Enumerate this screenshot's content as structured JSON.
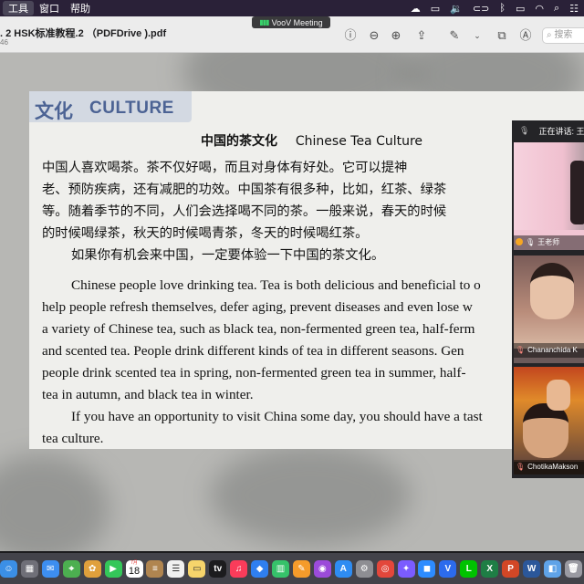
{
  "menubar": {
    "items": [
      "工具",
      "窗口",
      "帮助"
    ],
    "status_icons": [
      "cloud-icon",
      "cast-icon",
      "volume-icon",
      "link-icon",
      "bluetooth-icon",
      "battery-icon",
      "wifi-icon",
      "spotlight-icon",
      "control-center-icon"
    ]
  },
  "meeting_indicator": {
    "label": "VooV Meeting",
    "color": "#38d16a"
  },
  "window": {
    "title": ". 2 HSK标准教程.2 （PDFDrive ).pdf",
    "subtitle": "46",
    "search_placeholder": "搜索"
  },
  "page": {
    "culture_cn": "文化",
    "culture_en": "CULTURE",
    "title_cn": "中国的茶文化",
    "title_en": "Chinese Tea Culture",
    "cn_lines": [
      "中国人喜欢喝茶。茶不仅好喝，而且对身体有好处。它可以提神",
      "老、预防疾病，还有减肥的功效。中国茶有很多种，比如，红茶、绿茶",
      "等。随着季节的不同，人们会选择喝不同的茶。一般来说，春天的时候",
      "的时候喝绿茶，秋天的时候喝青茶，冬天的时候喝红茶。",
      "如果你有机会来中国，一定要体验一下中国的茶文化。"
    ],
    "en_lines": [
      "Chinese people love drinking tea. Tea is both delicious and beneficial to o",
      "help people refresh themselves, defer aging, prevent diseases and even lose w",
      "a variety of Chinese tea, such as black tea, non-fermented green tea, half-ferm",
      "and scented tea. People drink different kinds of tea in different seasons. Gen",
      "people drink scented tea in spring, non-fermented green tea in summer, half-",
      "tea in autumn, and black tea in winter.",
      "If you have an opportunity to visit China some day, you should have a tast",
      "tea culture."
    ]
  },
  "participants": {
    "header": "正在讲话: 王",
    "tiles": [
      {
        "name": "王老师"
      },
      {
        "name": "Chananchida K"
      },
      {
        "name": "ChotikaMakson"
      }
    ]
  },
  "dock": {
    "apps": [
      {
        "name": "finder-icon",
        "color": "#3b8fe6",
        "glyph": "☺"
      },
      {
        "name": "launchpad-icon",
        "color": "#6f6f78",
        "glyph": "▦"
      },
      {
        "name": "mail-icon",
        "color": "#3d8ef0",
        "glyph": "✉"
      },
      {
        "name": "maps-icon",
        "color": "#4caf50",
        "glyph": "⌖"
      },
      {
        "name": "photos-icon",
        "color": "#e0a03c",
        "glyph": "✿"
      },
      {
        "name": "facetime-icon",
        "color": "#34c759",
        "glyph": "▶"
      },
      {
        "name": "calendar-icon",
        "color": "#ffffff",
        "glyph": ""
      },
      {
        "name": "notes-brown-icon",
        "color": "#b08550",
        "glyph": "≡"
      },
      {
        "name": "reminders-icon",
        "color": "#f0f0f0",
        "glyph": "☰"
      },
      {
        "name": "notes-icon",
        "color": "#f6d46b",
        "glyph": "▭"
      },
      {
        "name": "tv-icon",
        "color": "#1c1c1e",
        "glyph": "tv"
      },
      {
        "name": "music-icon",
        "color": "#fa3c5a",
        "glyph": "♫"
      },
      {
        "name": "keynote-icon",
        "color": "#2f7ff0",
        "glyph": "◆"
      },
      {
        "name": "numbers-icon",
        "color": "#36c26a",
        "glyph": "▥"
      },
      {
        "name": "pages-icon",
        "color": "#f59b2b",
        "glyph": "✎"
      },
      {
        "name": "podcasts-icon",
        "color": "#9b4bd9",
        "glyph": "◉"
      },
      {
        "name": "appstore-icon",
        "color": "#2e8cf2",
        "glyph": "A"
      },
      {
        "name": "settings-icon",
        "color": "#8e8e93",
        "glyph": "⚙"
      },
      {
        "name": "chrome-icon",
        "color": "#e3473b",
        "glyph": "◎"
      },
      {
        "name": "messenger-icon",
        "color": "#7b5cff",
        "glyph": "✦"
      },
      {
        "name": "zoom-icon",
        "color": "#2d8cff",
        "glyph": "◼"
      },
      {
        "name": "voov-icon",
        "color": "#2c6bed",
        "glyph": "V"
      },
      {
        "name": "line-icon",
        "color": "#00c300",
        "glyph": "L"
      },
      {
        "name": "excel-icon",
        "color": "#1e7e45",
        "glyph": "X"
      },
      {
        "name": "powerpoint-icon",
        "color": "#d24726",
        "glyph": "P"
      },
      {
        "name": "word-icon",
        "color": "#2b579a",
        "glyph": "W"
      },
      {
        "name": "preview-icon",
        "color": "#5fa3e8",
        "glyph": "◧"
      },
      {
        "name": "trash-icon",
        "color": "#9a9aa2",
        "glyph": "🗑"
      }
    ],
    "calendar": {
      "month": "7月",
      "day": "18"
    }
  }
}
